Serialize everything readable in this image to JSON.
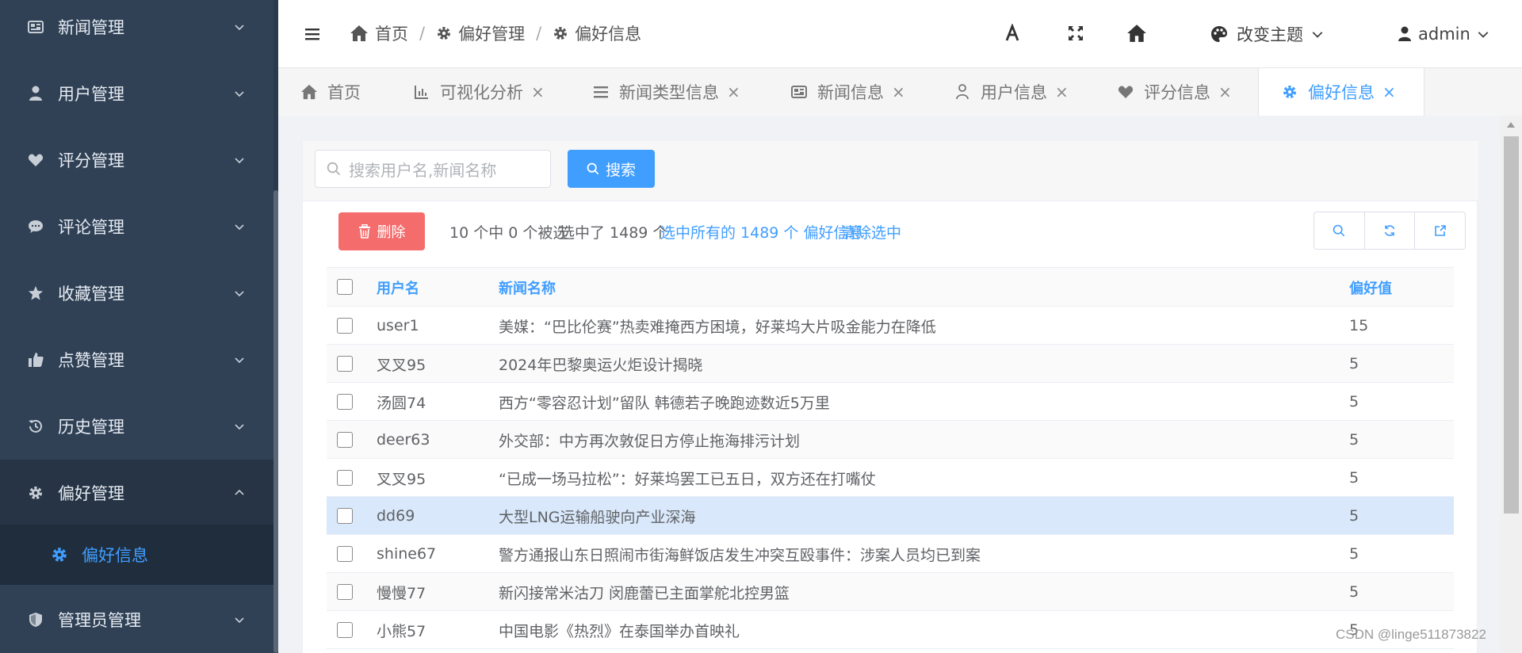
{
  "sidebar": {
    "items": [
      {
        "label": "新闻管理",
        "icon": "newspaper-icon",
        "name": "sidebar-item-news"
      },
      {
        "label": "用户管理",
        "icon": "user-icon",
        "name": "sidebar-item-users"
      },
      {
        "label": "评分管理",
        "icon": "heart-icon",
        "name": "sidebar-item-ratings"
      },
      {
        "label": "评论管理",
        "icon": "comment-icon",
        "name": "sidebar-item-comments"
      },
      {
        "label": "收藏管理",
        "icon": "star-icon",
        "name": "sidebar-item-favorites"
      },
      {
        "label": "点赞管理",
        "icon": "thumbs-up-icon",
        "name": "sidebar-item-likes"
      },
      {
        "label": "历史管理",
        "icon": "history-icon",
        "name": "sidebar-item-history"
      },
      {
        "label": "偏好管理",
        "icon": "gear-icon",
        "name": "sidebar-item-preferences"
      },
      {
        "label": "管理员管理",
        "icon": "shield-icon",
        "name": "sidebar-item-admins"
      }
    ],
    "subitem": {
      "label": "偏好信息",
      "icon": "gear-icon"
    }
  },
  "navbar": {
    "breadcrumb": [
      "首页",
      "偏好管理",
      "偏好信息"
    ],
    "theme_label": "改变主题",
    "user_label": "admin"
  },
  "tags": [
    {
      "label": "首页",
      "icon": "home-icon",
      "closable": false
    },
    {
      "label": "可视化分析",
      "icon": "chart-icon",
      "closable": true
    },
    {
      "label": "新闻类型信息",
      "icon": "list-icon",
      "closable": true
    },
    {
      "label": "新闻信息",
      "icon": "newspaper-icon",
      "closable": true
    },
    {
      "label": "用户信息",
      "icon": "user-icon",
      "closable": true
    },
    {
      "label": "评分信息",
      "icon": "heart-icon",
      "closable": true
    },
    {
      "label": "偏好信息",
      "icon": "gear-icon",
      "closable": true,
      "active": true
    }
  ],
  "search": {
    "placeholder": "搜索用户名,新闻名称",
    "button_label": "搜索"
  },
  "toolbar": {
    "delete_label": "删除",
    "selection_info": "10 个中 0 个被选",
    "selected_count": "选中了 1489 个",
    "select_all_link": "选中所有的 1489 个 偏好信息",
    "clear_link": "清除选中"
  },
  "table": {
    "headers": {
      "user": "用户名",
      "news": "新闻名称",
      "value": "偏好值"
    },
    "rows": [
      {
        "user": "user1",
        "news": "美媒：“巴比伦赛”热卖难掩西方困境，好莱坞大片吸金能力在降低",
        "value": "15"
      },
      {
        "user": "叉叉95",
        "news": "2024年巴黎奥运火炬设计揭晓",
        "value": "5"
      },
      {
        "user": "汤圆74",
        "news": "西方“零容忍计划”留队 韩德若子晚跑迹数近5万里",
        "value": "5"
      },
      {
        "user": "deer63",
        "news": "外交部：中方再次敦促日方停止拖海排污计划",
        "value": "5"
      },
      {
        "user": "叉叉95",
        "news": "“已成一场马拉松”：好莱坞罢工已五日，双方还在打嘴仗",
        "value": "5"
      },
      {
        "user": "dd69",
        "news": "大型LNG运输船驶向产业深海",
        "value": "5"
      },
      {
        "user": "shine67",
        "news": "警方通报山东日照闹市街海鲜饭店发生冲突互殴事件：涉案人员均已到案",
        "value": "5"
      },
      {
        "user": "慢慢77",
        "news": "新闪接常米沽刀 闵鹿蕾已主面掌舵北控男篮",
        "value": "5"
      },
      {
        "user": "小熊57",
        "news": "中国电影《热烈》在泰国举办首映礼",
        "value": "5"
      }
    ]
  },
  "watermark": "CSDN @linge511873822",
  "colors": {
    "sidebar_bg": "#304156",
    "accent": "#409eff",
    "danger": "#f56c6c",
    "selected_row": "#d9e8fa"
  }
}
